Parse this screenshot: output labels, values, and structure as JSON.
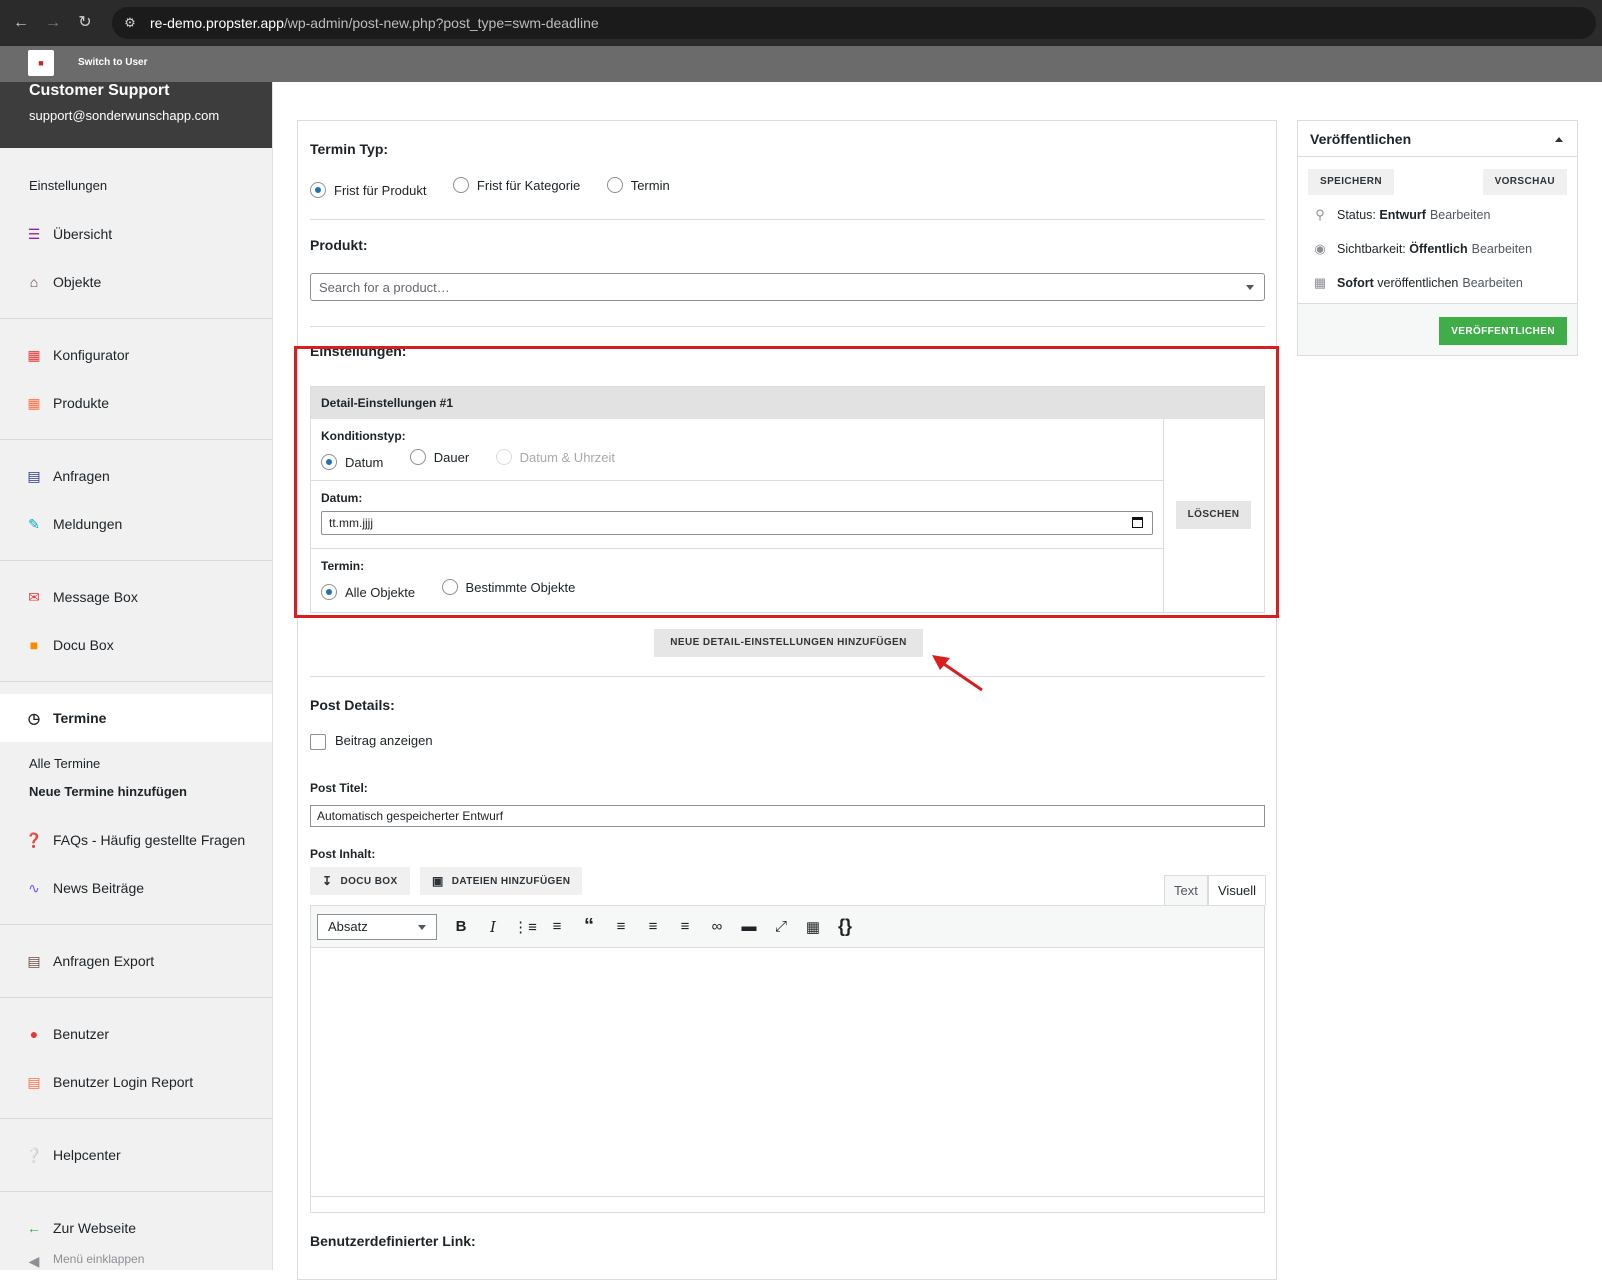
{
  "browser": {
    "url_host": "re-demo.propster.app",
    "url_path": "/wp-admin/post-new.php?post_type=swm-deadline"
  },
  "adminbar": {
    "switch_label": "Switch to User"
  },
  "sidebar": {
    "profile_name": "Customer Support",
    "profile_email": "support@sonderwunschapp.com",
    "section_label": "Einstellungen",
    "items": [
      {
        "label": "Übersicht",
        "icon": "menu-icon",
        "color": "#8e24aa"
      },
      {
        "label": "Objekte",
        "icon": "home-icon",
        "color": "#5d4037"
      },
      {
        "label": "Konfigurator",
        "icon": "sitemap-icon",
        "color": "#e53935"
      },
      {
        "label": "Produkte",
        "icon": "grid-icon",
        "color": "#ff7043"
      },
      {
        "label": "Anfragen",
        "icon": "list-icon",
        "color": "#283593"
      },
      {
        "label": "Meldungen",
        "icon": "edit-icon",
        "color": "#00acc1"
      },
      {
        "label": "Message Box",
        "icon": "message-icon",
        "color": "#e53935"
      },
      {
        "label": "Docu Box",
        "icon": "folder-icon",
        "color": "#fb8c00"
      },
      {
        "label": "Termine",
        "icon": "clock-icon",
        "color": "#1d2327"
      },
      {
        "label": "FAQs - Häufig gestellte Fragen",
        "icon": "help-icon",
        "color": "#3c434a"
      },
      {
        "label": "News Beiträge",
        "icon": "rss-icon",
        "color": "#7c4dff"
      },
      {
        "label": "Anfragen Export",
        "icon": "export-icon",
        "color": "#6d4c41"
      },
      {
        "label": "Benutzer",
        "icon": "user-icon",
        "color": "#e53935"
      },
      {
        "label": "Benutzer Login Report",
        "icon": "report-icon",
        "color": "#ff7043"
      },
      {
        "label": "Helpcenter",
        "icon": "question-icon",
        "color": "#283593"
      },
      {
        "label": "Zur Webseite",
        "icon": "arrow-left-icon",
        "color": "#43a047"
      }
    ],
    "sub_items": [
      "Alle Termine",
      "Neue Termine hinzufügen"
    ],
    "collapse_label": "Menü einklappen"
  },
  "form": {
    "termin_typ_label": "Termin Typ:",
    "termin_typ_options": [
      "Frist für Produkt",
      "Frist für Kategorie",
      "Termin"
    ],
    "produkt_label": "Produkt:",
    "produkt_placeholder": "Search for a product…",
    "einstellungen_label": "Einstellungen:",
    "detail_title": "Detail-Einstellungen #1",
    "konditionstyp_label": "Konditionstyp:",
    "konditionstyp_options": [
      "Datum",
      "Dauer",
      "Datum & Uhrzeit"
    ],
    "datum_label": "Datum:",
    "datum_placeholder": "tt.mm.jjjj",
    "termin_label": "Termin:",
    "termin_options": [
      "Alle Objekte",
      "Bestimmte Objekte"
    ],
    "loeschen_label": "LÖSCHEN",
    "add_detail_label": "NEUE DETAIL-EINSTELLUNGEN HINZUFÜGEN",
    "post_details_label": "Post Details:",
    "beitrag_anzeigen_label": "Beitrag anzeigen",
    "post_titel_label": "Post Titel:",
    "post_titel_value": "Automatisch gespeicherter Entwurf",
    "post_inhalt_label": "Post Inhalt:",
    "docu_box_label": "DOCU BOX",
    "dateien_label": "DATEIEN HINZUFÜGEN",
    "tab_text": "Text",
    "tab_visuell": "Visuell",
    "format_select": "Absatz",
    "custom_link_label": "Benutzerdefinierter Link:"
  },
  "publish": {
    "title": "Veröffentlichen",
    "save_label": "SPEICHERN",
    "preview_label": "VORSCHAU",
    "status_key": "Status:",
    "status_value": "Entwurf",
    "visibility_key": "Sichtbarkeit:",
    "visibility_value": "Öffentlich",
    "schedule_value": "Sofort",
    "schedule_key": "veröffentlichen",
    "edit_link": "Bearbeiten",
    "publish_label": "VERÖFFENTLICHEN"
  },
  "colors": {
    "highlight": "#d81e1e",
    "publish_green": "#3fae49",
    "radio_selected": "#2271b1"
  }
}
